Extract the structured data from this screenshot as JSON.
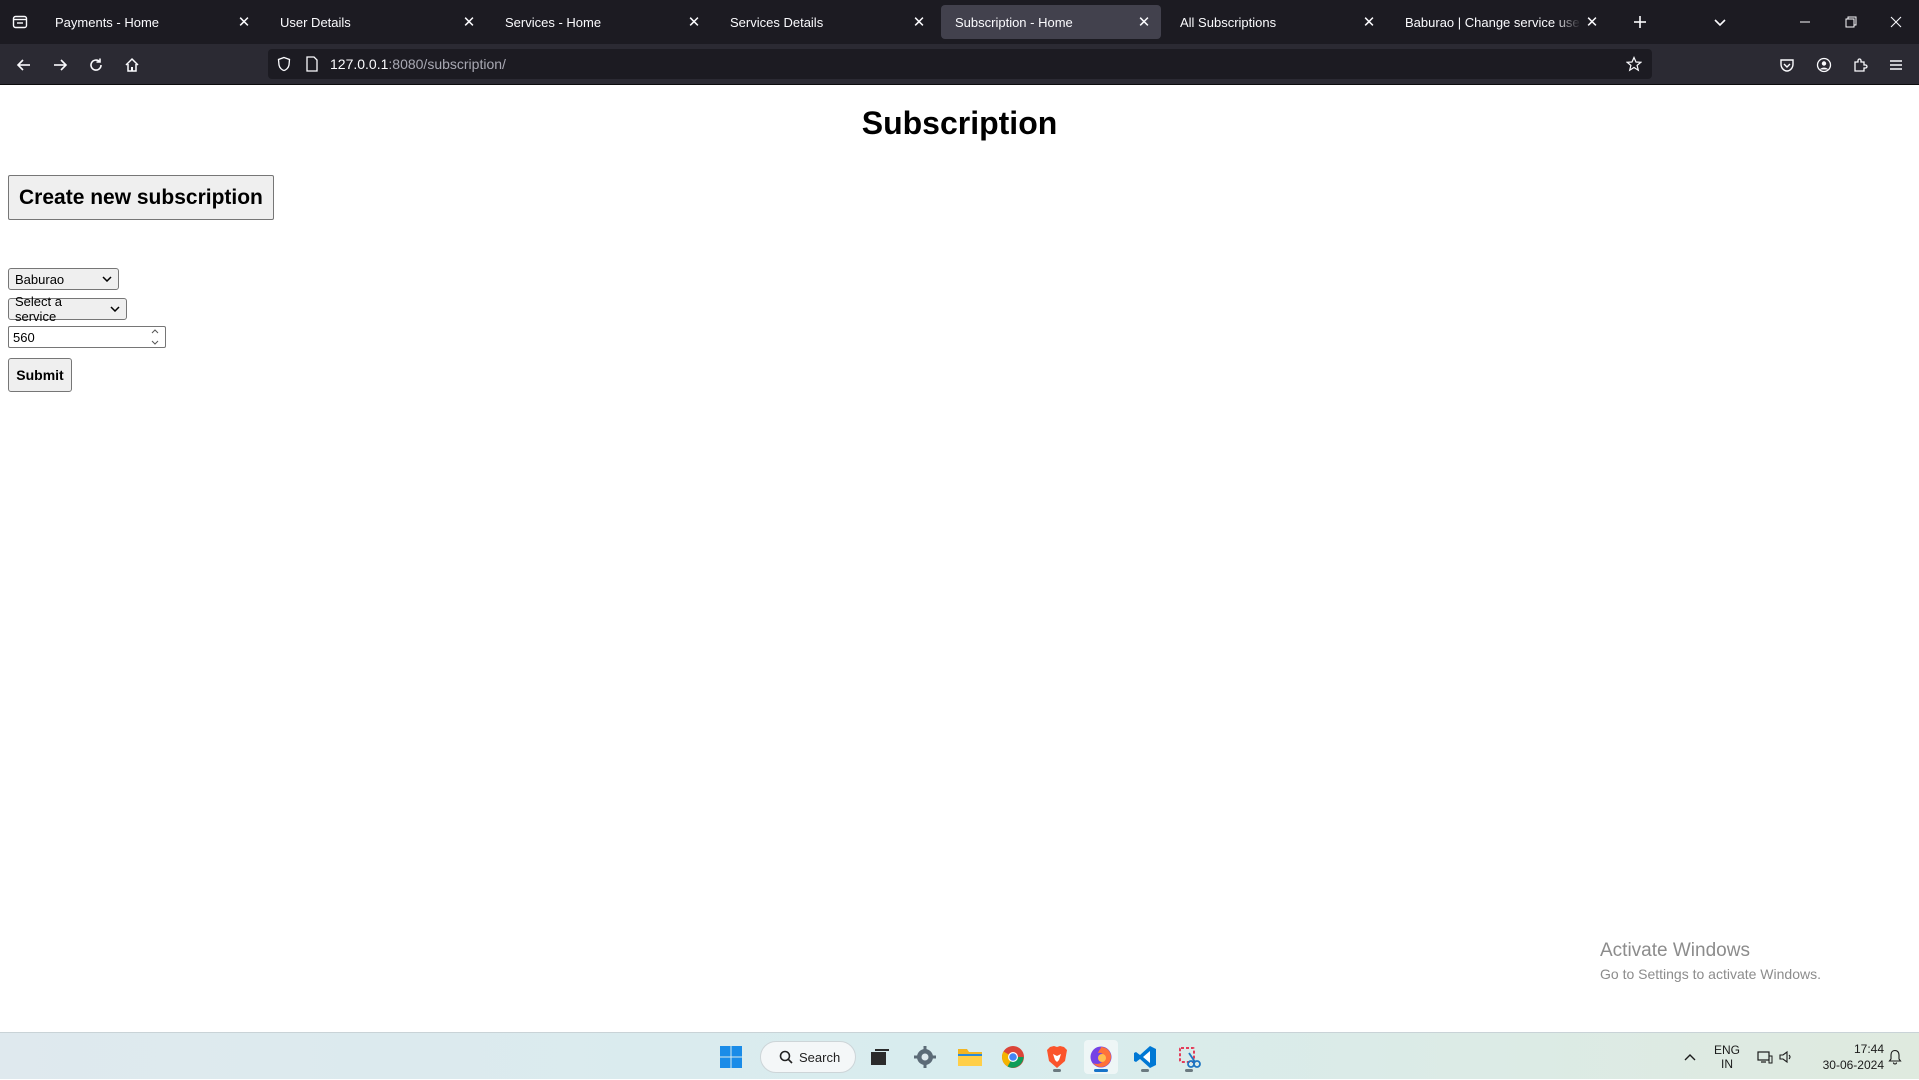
{
  "browser": {
    "tabs": [
      {
        "title": "Payments - Home",
        "active": false
      },
      {
        "title": "User Details",
        "active": false
      },
      {
        "title": "Services - Home",
        "active": false
      },
      {
        "title": "Services Details",
        "active": false
      },
      {
        "title": "Subscription - Home",
        "active": true
      },
      {
        "title": "All Subscriptions",
        "active": false
      },
      {
        "title": "Baburao | Change service user | Djan",
        "active": false
      }
    ],
    "url_host": "127.0.0.1",
    "url_rest": ":8080/subscription/"
  },
  "page": {
    "title": "Subscription",
    "create_button": "Create new subscription",
    "user_select_value": "Baburao",
    "service_select_value": "Select a service",
    "amount_value": "560",
    "submit_label": "Submit"
  },
  "watermark": {
    "line1": "Activate Windows",
    "line2": "Go to Settings to activate Windows."
  },
  "taskbar": {
    "search_label": "Search",
    "lang_line1": "ENG",
    "lang_line2": "IN",
    "time": "17:44",
    "date": "30-06-2024"
  },
  "colors": {
    "tab_strip": "#1c1b22",
    "toolbar": "#2b2a33",
    "active_tab": "#42414d",
    "taskbar_accent": "#1773c9"
  }
}
